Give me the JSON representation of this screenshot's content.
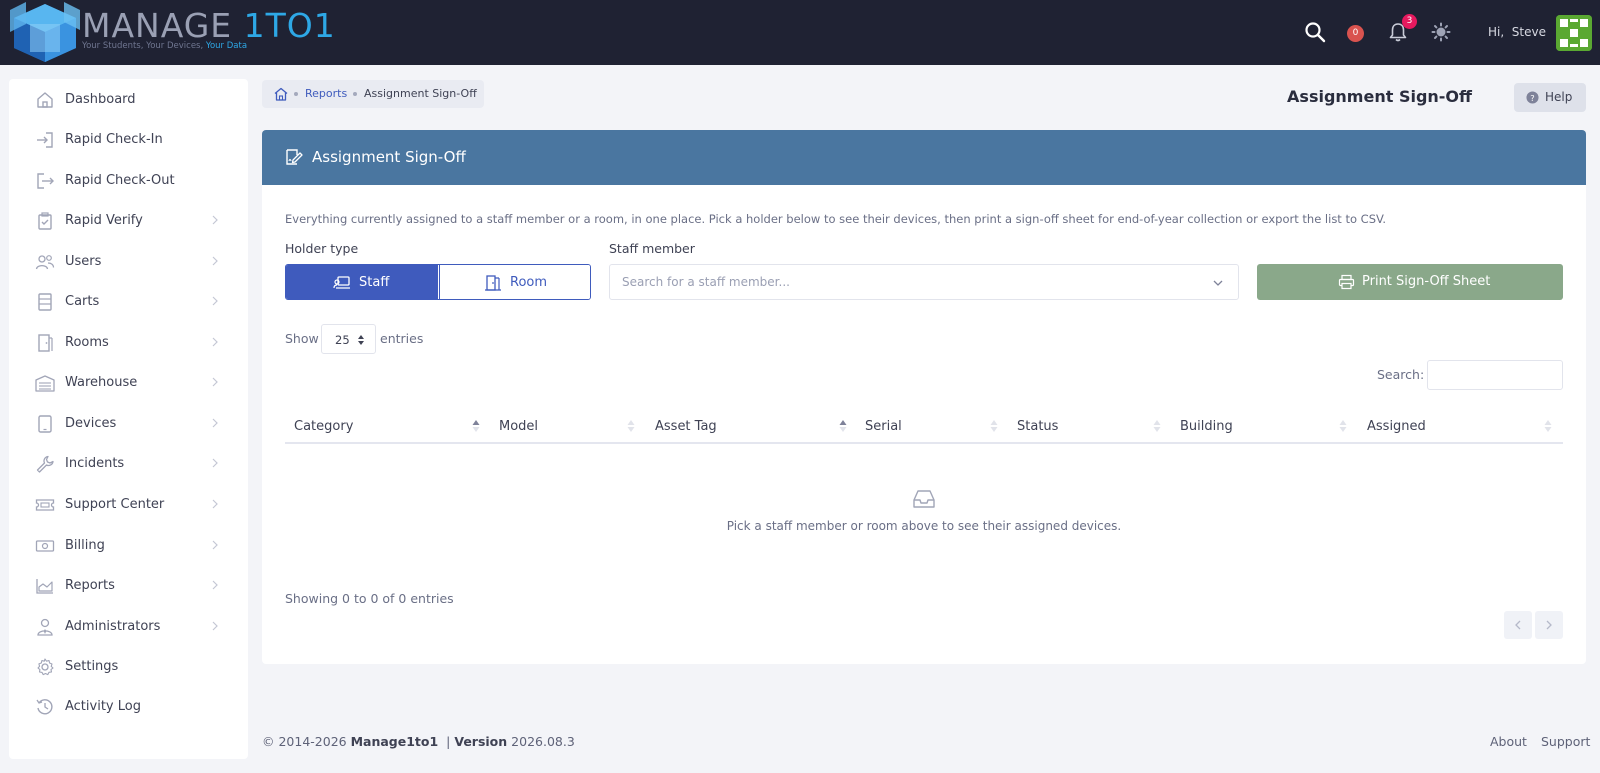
{
  "app": {
    "brand_main": "MANAGE ",
    "brand_accent": "1TO1",
    "tagline_main": "Your Students, Your Devices, ",
    "tagline_accent": "Your Data"
  },
  "topbar": {
    "search_icon": "search-icon",
    "incidents_count": "0",
    "notifications_count": "3",
    "greeting_hi": "Hi,",
    "user_name": "Steve"
  },
  "sidebar": {
    "items": [
      {
        "label": "Dashboard",
        "icon": "home-icon"
      },
      {
        "label": "Rapid Check-In",
        "icon": "sign-in-icon"
      },
      {
        "label": "Rapid Check-Out",
        "icon": "sign-out-icon"
      },
      {
        "label": "Rapid Verify",
        "icon": "clipboard-check-icon"
      },
      {
        "label": "Users",
        "icon": "users-icon"
      },
      {
        "label": "Carts",
        "icon": "cart-icon"
      },
      {
        "label": "Rooms",
        "icon": "door-icon"
      },
      {
        "label": "Warehouse",
        "icon": "warehouse-icon"
      },
      {
        "label": "Devices",
        "icon": "device-icon"
      },
      {
        "label": "Incidents",
        "icon": "wrench-icon"
      },
      {
        "label": "Support Center",
        "icon": "ticket-icon"
      },
      {
        "label": "Billing",
        "icon": "money-icon"
      },
      {
        "label": "Reports",
        "icon": "chart-area-icon"
      },
      {
        "label": "Administrators",
        "icon": "user-tie-icon"
      },
      {
        "label": "Settings",
        "icon": "gear-icon"
      },
      {
        "label": "Activity Log",
        "icon": "history-icon"
      }
    ]
  },
  "breadcrumb": {
    "parent": "Reports",
    "current": "Assignment Sign-Off"
  },
  "page": {
    "title": "Assignment Sign-Off",
    "help_label": "Help"
  },
  "card": {
    "title": "Assignment Sign-Off",
    "intro": "Everything currently assigned to a staff member or a room, in one place. Pick a holder below to see their devices, then print a sign-off sheet for end-of-year collection or export the list to CSV.",
    "holder_type_label": "Holder type",
    "holder_options": [
      "Staff",
      "Room"
    ],
    "staff_member_label": "Staff member",
    "staff_placeholder": "Search for a staff member...",
    "print_label": "Print Sign-Off Sheet"
  },
  "table": {
    "show_label": "Show",
    "entries_value": "25",
    "entries_label": "entries",
    "search_label": "Search:",
    "columns": [
      "Category",
      "Model",
      "Asset Tag",
      "Serial",
      "Status",
      "Building",
      "Assigned"
    ],
    "empty_message": "Pick a staff member or room above to see their assigned devices.",
    "showing_text": "Showing 0 to 0 of 0 entries"
  },
  "footer": {
    "copyright": "© 2014-2026 ",
    "brand": "Manage1to1",
    "separator": "  | ",
    "version_label": "Version",
    "version_number": " 2026.08.3",
    "about": "About",
    "support": "Support"
  },
  "colors": {
    "topbar": "#1f2233",
    "primary": "#3f5bbd",
    "card_header": "#4a76a0",
    "print_button": "#8aa88a",
    "incident_badge": "#d9534f",
    "notification_badge": "#e6195e"
  }
}
